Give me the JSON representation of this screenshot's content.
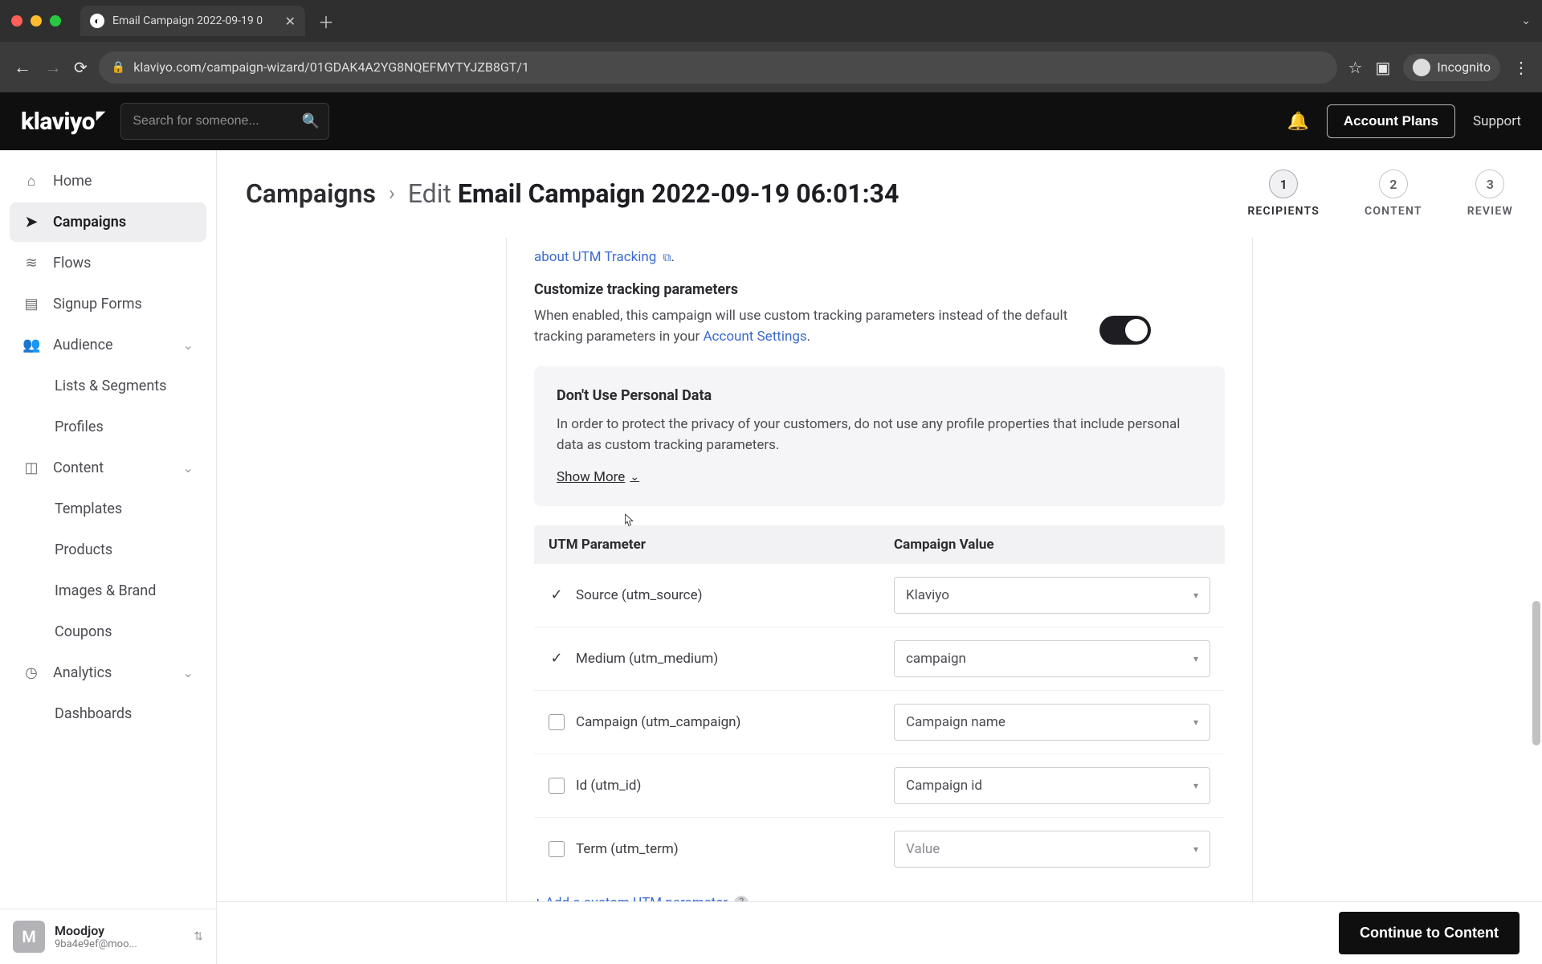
{
  "browser": {
    "tab_title": "Email Campaign 2022-09-19 0",
    "url": "klaviyo.com/campaign-wizard/01GDAK4A2YG8NQEFMYTYJZB8GT/1",
    "incognito_label": "Incognito"
  },
  "topbar": {
    "logo": "klaviyo",
    "search_placeholder": "Search for someone...",
    "account_plans": "Account Plans",
    "support": "Support"
  },
  "sidebar": {
    "items": [
      {
        "label": "Home"
      },
      {
        "label": "Campaigns"
      },
      {
        "label": "Flows"
      },
      {
        "label": "Signup Forms"
      },
      {
        "label": "Audience"
      },
      {
        "label": "Lists & Segments"
      },
      {
        "label": "Profiles"
      },
      {
        "label": "Content"
      },
      {
        "label": "Templates"
      },
      {
        "label": "Products"
      },
      {
        "label": "Images & Brand"
      },
      {
        "label": "Coupons"
      },
      {
        "label": "Analytics"
      },
      {
        "label": "Dashboards"
      }
    ],
    "user": {
      "name": "Moodjoy",
      "email": "9ba4e9ef@moo...",
      "initial": "M"
    }
  },
  "header": {
    "crumb": "Campaigns",
    "edit_prefix": "Edit ",
    "title": "Email Campaign 2022-09-19 06:01:34",
    "steps": [
      {
        "num": "1",
        "label": "RECIPIENTS"
      },
      {
        "num": "2",
        "label": "CONTENT"
      },
      {
        "num": "3",
        "label": "REVIEW"
      }
    ]
  },
  "content": {
    "utm_about_link": "about UTM Tracking",
    "customize_title": "Customize tracking parameters",
    "customize_body_pre": "When enabled, this campaign will use custom tracking parameters instead of the default tracking parameters in your ",
    "account_settings_link": "Account Settings",
    "info_title": "Don't Use Personal Data",
    "info_body": "In order to protect the privacy of your customers, do not use any profile properties that include personal data as custom tracking parameters.",
    "show_more": "Show More",
    "table": {
      "col_param": "UTM Parameter",
      "col_value": "Campaign Value",
      "rows": [
        {
          "checked": true,
          "param": "Source (utm_source)",
          "value": "Klaviyo",
          "placeholder": false
        },
        {
          "checked": true,
          "param": "Medium (utm_medium)",
          "value": "campaign",
          "placeholder": false
        },
        {
          "checked": false,
          "param": "Campaign (utm_campaign)",
          "value": "Campaign name",
          "placeholder": false
        },
        {
          "checked": false,
          "param": "Id (utm_id)",
          "value": "Campaign id",
          "placeholder": false
        },
        {
          "checked": false,
          "param": "Term (utm_term)",
          "value": "Value",
          "placeholder": true
        }
      ]
    },
    "add_custom": "+ Add a custom UTM parameter"
  },
  "footer": {
    "continue": "Continue to Content"
  }
}
